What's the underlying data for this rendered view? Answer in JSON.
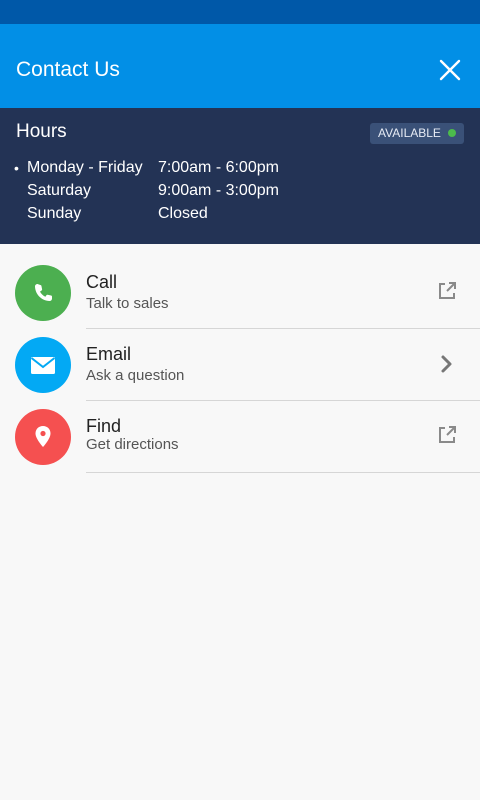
{
  "header": {
    "title": "Contact Us",
    "close_icon": "close-icon",
    "color": "#028fe6",
    "status_bar_color": "#0058a8"
  },
  "hours": {
    "title": "Hours",
    "status": "AVAILABLE",
    "status_color": "#4cbb4c",
    "rows": [
      {
        "bullet": "•",
        "day": "Monday - Friday",
        "time": "7:00am - 6:00pm"
      },
      {
        "bullet": "",
        "day": "Saturday",
        "time": "9:00am - 3:00pm"
      },
      {
        "bullet": "",
        "day": "Sunday",
        "time": "Closed"
      }
    ]
  },
  "contacts": [
    {
      "title": "Call",
      "subtitle": "Talk to sales",
      "icon": "phone-icon",
      "color": "#4caf50",
      "action_icon": "external-link-icon"
    },
    {
      "title": "Email",
      "subtitle": "Ask a question",
      "icon": "envelope-icon",
      "color": "#03a9f4",
      "action_icon": "chevron-right-icon"
    },
    {
      "title": "Find",
      "subtitle": "Get directions",
      "icon": "map-pin-icon",
      "color": "#f55050",
      "action_icon": "external-link-icon"
    }
  ]
}
